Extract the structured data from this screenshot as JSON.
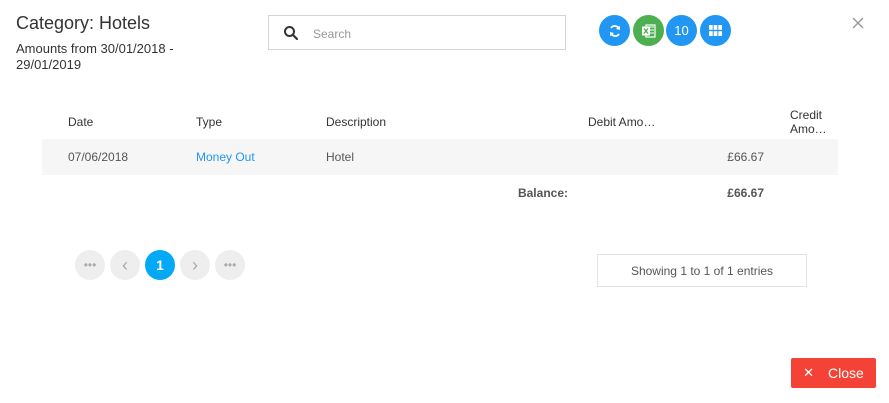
{
  "header": {
    "title": "Category: Hotels",
    "subtitle": "Amounts from 30/01/2018 - 29/01/2019"
  },
  "search": {
    "placeholder": "Search",
    "value": ""
  },
  "toolbar": {
    "refresh_icon": "refresh-icon",
    "excel_icon": "excel-icon",
    "page_size_label": "10",
    "columns_icon": "grid-icon",
    "colors": {
      "blue": "#2196f3",
      "green": "#4caf50"
    }
  },
  "table": {
    "columns": [
      "Date",
      "Type",
      "Description",
      "Debit Amo…",
      "Credit Amo…"
    ],
    "rows": [
      {
        "date": "07/06/2018",
        "type": "Money Out",
        "description": "Hotel",
        "debit": "£66.67",
        "credit": ""
      }
    ],
    "balance_label": "Balance:",
    "balance_value": "£66.67"
  },
  "pagination": {
    "first_label": "•••",
    "prev_label": "‹",
    "current_page": "1",
    "next_label": "›",
    "last_label": "•••"
  },
  "info": "Showing 1 to 1 of 1 entries",
  "footer": {
    "close_label": "Close",
    "close_color": "#f44336"
  }
}
